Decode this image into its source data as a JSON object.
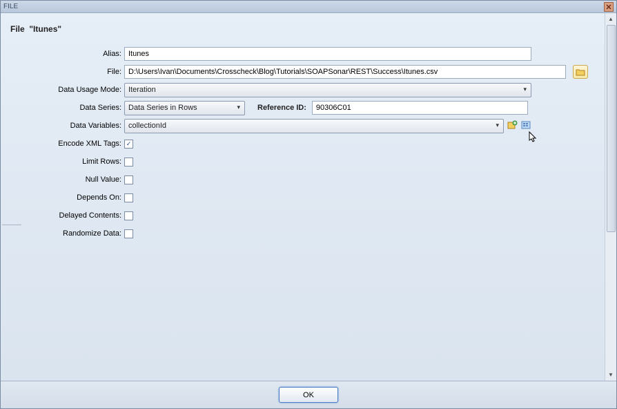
{
  "window": {
    "title": "FILE"
  },
  "heading": {
    "prefix": "File",
    "quoted_name": "\"Itunes\""
  },
  "labels": {
    "alias": "Alias:",
    "file": "File:",
    "data_usage_mode": "Data Usage Mode:",
    "data_series": "Data Series:",
    "reference_id": "Reference ID:",
    "data_variables": "Data Variables:",
    "encode_xml_tags": "Encode XML Tags:",
    "limit_rows": "Limit Rows:",
    "null_value": "Null Value:",
    "depends_on": "Depends On:",
    "delayed_contents": "Delayed Contents:",
    "randomize_data": "Randomize Data:"
  },
  "values": {
    "alias": "Itunes",
    "file": "D:\\Users\\Ivan\\Documents\\Crosscheck\\Blog\\Tutorials\\SOAPSonar\\REST\\Success\\Itunes.csv",
    "data_usage_mode": "Iteration",
    "data_series": "Data Series in Rows",
    "reference_id": "90306C01",
    "data_variables": "collectionId"
  },
  "check": {
    "encode_xml_tags": true,
    "limit_rows": false,
    "null_value": false,
    "depends_on": false,
    "delayed_contents": false,
    "randomize_data": false
  },
  "buttons": {
    "ok": "OK"
  },
  "icons": {
    "close": "close-icon",
    "folder": "folder-icon",
    "add_var": "add-variable-icon",
    "edit_var": "edit-variable-icon"
  }
}
